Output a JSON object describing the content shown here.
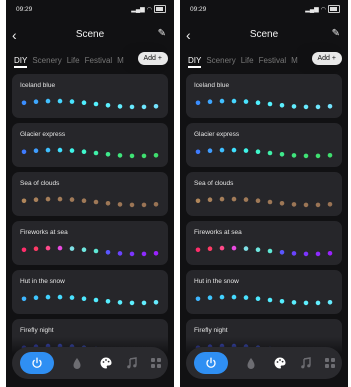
{
  "screens": [
    {
      "status": {
        "time": "09:29",
        "battery": "100"
      },
      "header": {
        "title": "Scene"
      },
      "tabs": [
        "DIY",
        "Scenery",
        "Life",
        "Festival",
        "M"
      ],
      "add_label": "Add +",
      "scenes": [
        {
          "name": "Iceland blue",
          "colors": [
            "#3a8dff",
            "#3ea7ff",
            "#42c0ff",
            "#46d6ff",
            "#4ae4ff",
            "#4ff0ff",
            "#55f2ff",
            "#5cf0ff",
            "#62eeff",
            "#68eaff",
            "#6ee7ff",
            "#74e4ff"
          ]
        },
        {
          "name": "Glacier express",
          "colors": [
            "#3e7bff",
            "#3f9dff",
            "#3fbfff",
            "#3fe0ff",
            "#3ff4e8",
            "#3ff8cc",
            "#3ff0a8",
            "#3fea8c",
            "#3fe57c",
            "#3fe274",
            "#3fe070",
            "#3fde6e"
          ]
        },
        {
          "name": "Sea of clouds",
          "colors": [
            "#b0865a",
            "#a9815b",
            "#a47d59",
            "#a27b58",
            "#a07a58",
            "#9f7957",
            "#9e7857",
            "#9d7756",
            "#9c7656",
            "#9b7555",
            "#9a7455",
            "#997354"
          ]
        },
        {
          "name": "Fireworks at sea",
          "colors": [
            "#ff2d6b",
            "#ff3a66",
            "#ff4a8a",
            "#e84ae0",
            "#7fe0e6",
            "#6fe7e0",
            "#5fe8d6",
            "#5a56ff",
            "#6a43ff",
            "#7c35ff",
            "#8e2bff",
            "#9a22ff"
          ]
        },
        {
          "name": "Hut in the snow",
          "colors": [
            "#3eb6ff",
            "#3fc6ff",
            "#42d2ff",
            "#46daff",
            "#4ae2ff",
            "#4ee8ff",
            "#52ecff",
            "#56eeff",
            "#5aefff",
            "#5eefff",
            "#62eeff",
            "#66ecff"
          ]
        },
        {
          "name": "Firefly night",
          "colors": [
            "#3d4bd8",
            "#3e4dd9",
            "#3f50da",
            "#4053da",
            "#4156db",
            "#4259dc",
            "#435bdd",
            "#445ddd",
            "#455fde",
            "#4661df",
            "#4763e0",
            "#4865e0"
          ]
        }
      ],
      "dock": {
        "active": "power-icon",
        "items": [
          "power-icon",
          "droplet-icon",
          "palette-icon",
          "music-icon",
          "grid-icon"
        ],
        "accent": "#2f8ff3"
      }
    },
    {
      "status": {
        "time": "09:29",
        "battery": "100"
      },
      "header": {
        "title": "Scene"
      },
      "tabs": [
        "DIY",
        "Scenery",
        "Life",
        "Festival",
        "M"
      ],
      "add_label": "Add +",
      "scenes": [
        {
          "name": "Iceland blue",
          "colors": [
            "#3a8dff",
            "#3ea7ff",
            "#42c0ff",
            "#46d6ff",
            "#4ae4ff",
            "#4ff0ff",
            "#55f2ff",
            "#5cf0ff",
            "#62eeff",
            "#68eaff",
            "#6ee7ff",
            "#74e4ff"
          ]
        },
        {
          "name": "Glacier express",
          "colors": [
            "#3e7bff",
            "#3f9dff",
            "#3fbfff",
            "#3fe0ff",
            "#3ff4e8",
            "#3ff8cc",
            "#3ff0a8",
            "#3fea8c",
            "#3fe57c",
            "#3fe274",
            "#3fe070",
            "#3fde6e"
          ]
        },
        {
          "name": "Sea of clouds",
          "colors": [
            "#b0865a",
            "#a9815b",
            "#a47d59",
            "#a27b58",
            "#a07a58",
            "#9f7957",
            "#9e7857",
            "#9d7756",
            "#9c7656",
            "#9b7555",
            "#9a7455",
            "#997354"
          ]
        },
        {
          "name": "Fireworks at sea",
          "colors": [
            "#ff2d6b",
            "#ff3a66",
            "#ff4a8a",
            "#e84ae0",
            "#7fe0e6",
            "#6fe7e0",
            "#5fe8d6",
            "#5a56ff",
            "#6a43ff",
            "#7c35ff",
            "#8e2bff",
            "#9a22ff"
          ]
        },
        {
          "name": "Hut in the snow",
          "colors": [
            "#3eb6ff",
            "#3fc6ff",
            "#42d2ff",
            "#46daff",
            "#4ae2ff",
            "#4ee8ff",
            "#52ecff",
            "#56eeff",
            "#5aefff",
            "#5eefff",
            "#62eeff",
            "#66ecff"
          ]
        },
        {
          "name": "Firefly night",
          "colors": [
            "#3d4bd8",
            "#3e4dd9",
            "#3f50da",
            "#4053da",
            "#4156db",
            "#4259dc",
            "#435bdd",
            "#445ddd",
            "#455fde",
            "#4661df",
            "#4763e0",
            "#4865e0"
          ]
        }
      ],
      "dock": {
        "active": "power-icon",
        "items": [
          "power-icon",
          "droplet-icon",
          "palette-icon",
          "music-icon",
          "grid-icon"
        ],
        "accent": "#2f8ff3"
      }
    }
  ]
}
